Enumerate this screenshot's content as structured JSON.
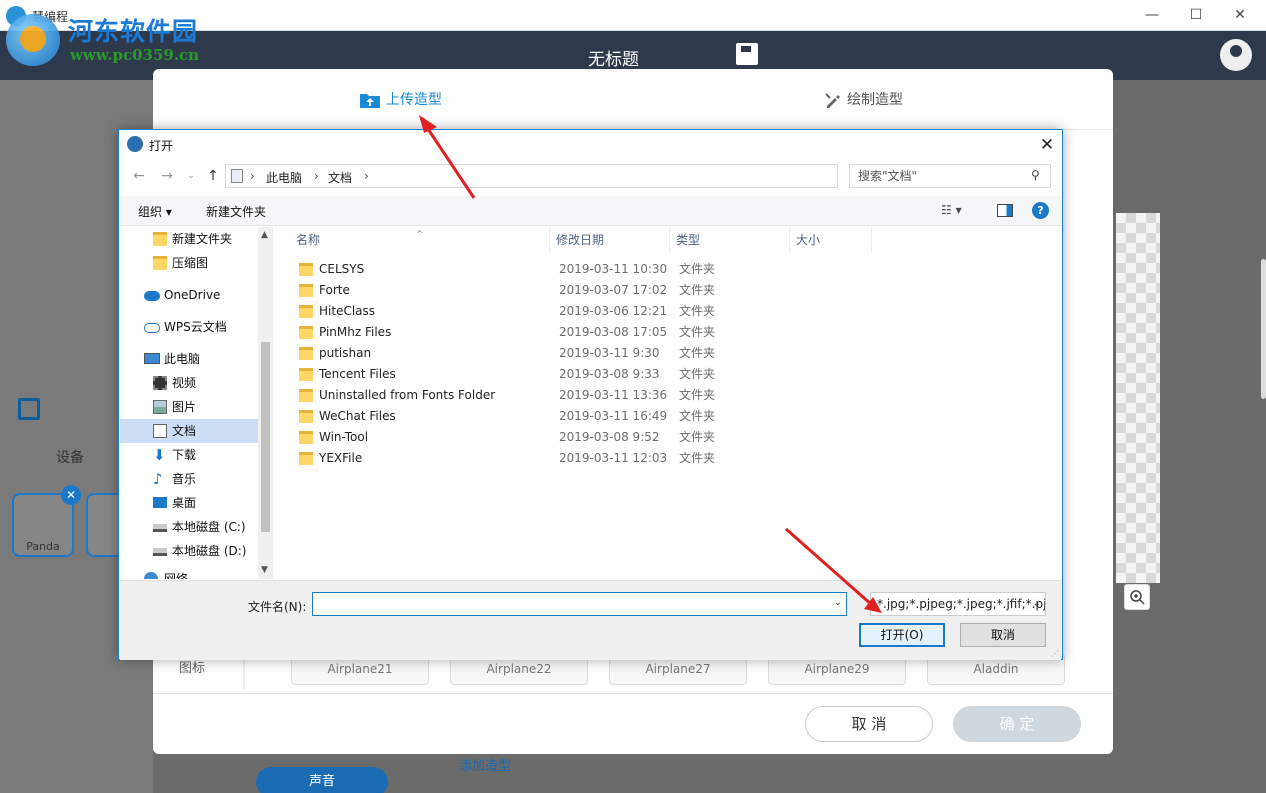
{
  "app": {
    "name": "慧编程",
    "doc_title": "无标题",
    "window_controls": {
      "minimize": "—",
      "maximize": "☐",
      "close": "✕"
    }
  },
  "watermark": {
    "title": "河东软件园",
    "url": "www.pc0359.cn"
  },
  "background": {
    "device_label": "设备",
    "sprite_name": "Panda",
    "sprite_close": "✕",
    "sound_button": "声音",
    "add_shape": "添加造型"
  },
  "modal": {
    "tabs": {
      "upload": "上传造型",
      "draw": "绘制造型"
    },
    "icon_label": "图标",
    "assets": [
      "Airplane21",
      "Airplane22",
      "Airplane27",
      "Airplane29",
      "Aladdin"
    ],
    "cancel": "取 消",
    "ok": "确 定"
  },
  "dialog": {
    "title": "打开",
    "close": "✕",
    "nav": {
      "back": "←",
      "forward": "→",
      "up": "↑"
    },
    "breadcrumb": [
      "此电脑",
      "文档"
    ],
    "search_placeholder": "搜索\"文档\"",
    "toolbar": {
      "organize": "组织 ▾",
      "new_folder": "新建文件夹",
      "help": "?"
    },
    "nav_pane": [
      {
        "label": "新建文件夹",
        "icon": "folder-icon"
      },
      {
        "label": "压缩图",
        "icon": "folder-icon"
      },
      {
        "label": "OneDrive",
        "icon": "onedrive-icon"
      },
      {
        "label": "WPS云文档",
        "icon": "cloud-icon"
      },
      {
        "label": "此电脑",
        "icon": "computer-icon"
      },
      {
        "label": "视频",
        "icon": "video-icon"
      },
      {
        "label": "图片",
        "icon": "pictures-icon"
      },
      {
        "label": "文档",
        "icon": "documents-icon"
      },
      {
        "label": "下载",
        "icon": "download-icon"
      },
      {
        "label": "音乐",
        "icon": "music-icon"
      },
      {
        "label": "桌面",
        "icon": "desktop-icon"
      },
      {
        "label": "本地磁盘 (C:)",
        "icon": "drive-icon"
      },
      {
        "label": "本地磁盘 (D:)",
        "icon": "drive-icon"
      },
      {
        "label": "网络",
        "icon": "network-icon"
      }
    ],
    "columns": {
      "name": "名称",
      "date": "修改日期",
      "type": "类型",
      "size": "大小"
    },
    "files": [
      {
        "name": "CELSYS",
        "date": "2019-03-11 10:30",
        "type": "文件夹"
      },
      {
        "name": "Forte",
        "date": "2019-03-07 17:02",
        "type": "文件夹"
      },
      {
        "name": "HiteClass",
        "date": "2019-03-06 12:21",
        "type": "文件夹"
      },
      {
        "name": "PinMhz Files",
        "date": "2019-03-08 17:05",
        "type": "文件夹"
      },
      {
        "name": "putishan",
        "date": "2019-03-11 9:30",
        "type": "文件夹"
      },
      {
        "name": "Tencent Files",
        "date": "2019-03-08 9:33",
        "type": "文件夹"
      },
      {
        "name": "Uninstalled from Fonts Folder",
        "date": "2019-03-11 13:36",
        "type": "文件夹"
      },
      {
        "name": "WeChat Files",
        "date": "2019-03-11 16:49",
        "type": "文件夹"
      },
      {
        "name": "Win-Tool",
        "date": "2019-03-08 9:52",
        "type": "文件夹"
      },
      {
        "name": "YEXFile",
        "date": "2019-03-11 12:03",
        "type": "文件夹"
      }
    ],
    "filename_label": "文件名(N):",
    "filename_value": "",
    "filter_value": "*.jpg;*.pjpeg;*.jpeg;*.jfif;*.pj",
    "open_button": "打开(O)",
    "cancel_button": "取消"
  },
  "colors": {
    "accent": "#1a8ad6",
    "arrow": "#e02020",
    "header": "#2e3a4c"
  }
}
